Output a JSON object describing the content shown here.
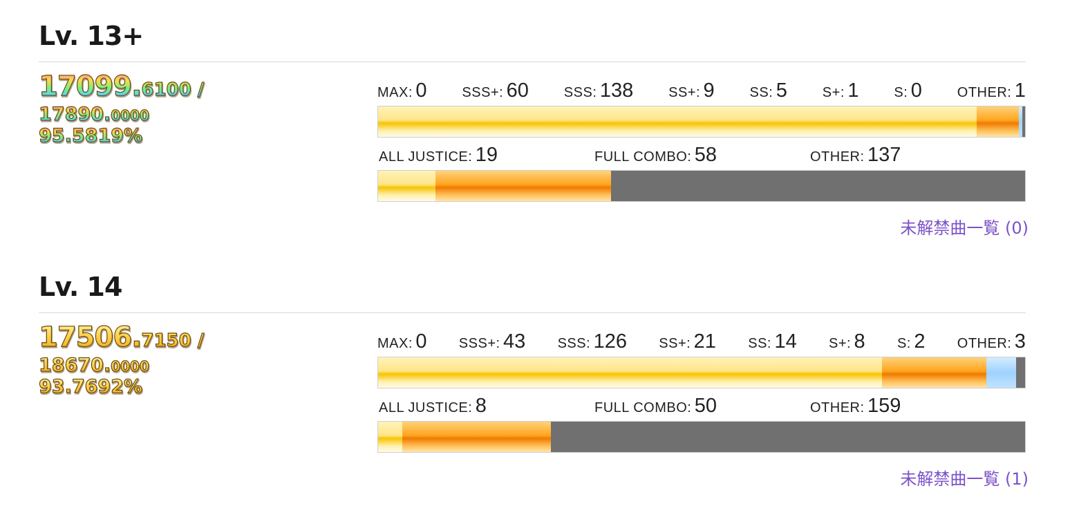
{
  "levels": [
    {
      "title": "Lv. 13+",
      "rating": {
        "current_int": "17099.",
        "current_dec": "6100 /",
        "max_int": "17890.",
        "max_dec": "0000",
        "percent": "95.5819%",
        "style": "rainbow"
      },
      "score_counts": [
        {
          "label": "MAX:",
          "value": "0"
        },
        {
          "label": "SSS+:",
          "value": "60"
        },
        {
          "label": "SSS:",
          "value": "138"
        },
        {
          "label": "SS+:",
          "value": "9"
        },
        {
          "label": "SS:",
          "value": "5"
        },
        {
          "label": "S+:",
          "value": "1"
        },
        {
          "label": "S:",
          "value": "0"
        },
        {
          "label": "OTHER:",
          "value": "1"
        }
      ],
      "score_bar": [
        {
          "kind": "yellow",
          "count": 198
        },
        {
          "kind": "orange",
          "count": 14
        },
        {
          "kind": "blue",
          "count": 1
        },
        {
          "kind": "gray",
          "count": 1
        }
      ],
      "combo_counts": [
        {
          "label": "ALL JUSTICE:",
          "value": "19"
        },
        {
          "label": "FULL COMBO:",
          "value": "58"
        },
        {
          "label": "OTHER:",
          "value": "137"
        }
      ],
      "combo_bar": [
        {
          "kind": "yellow",
          "count": 19
        },
        {
          "kind": "orange",
          "count": 58
        },
        {
          "kind": "gray",
          "count": 137
        }
      ],
      "link": "未解禁曲一覧 (0)"
    },
    {
      "title": "Lv. 14",
      "rating": {
        "current_int": "17506.",
        "current_dec": "7150 /",
        "max_int": "18670.",
        "max_dec": "0000",
        "percent": "93.7692%",
        "style": "gold"
      },
      "score_counts": [
        {
          "label": "MAX:",
          "value": "0"
        },
        {
          "label": "SSS+:",
          "value": "43"
        },
        {
          "label": "SSS:",
          "value": "126"
        },
        {
          "label": "SS+:",
          "value": "21"
        },
        {
          "label": "SS:",
          "value": "14"
        },
        {
          "label": "S+:",
          "value": "8"
        },
        {
          "label": "S:",
          "value": "2"
        },
        {
          "label": "OTHER:",
          "value": "3"
        }
      ],
      "score_bar": [
        {
          "kind": "yellow",
          "count": 169
        },
        {
          "kind": "orange",
          "count": 35
        },
        {
          "kind": "blue",
          "count": 10
        },
        {
          "kind": "gray",
          "count": 3
        }
      ],
      "combo_counts": [
        {
          "label": "ALL JUSTICE:",
          "value": "8"
        },
        {
          "label": "FULL COMBO:",
          "value": "50"
        },
        {
          "label": "OTHER:",
          "value": "159"
        }
      ],
      "combo_bar": [
        {
          "kind": "yellow",
          "count": 8
        },
        {
          "kind": "orange",
          "count": 50
        },
        {
          "kind": "gray",
          "count": 159
        }
      ],
      "link": "未解禁曲一覧 (1)"
    }
  ]
}
